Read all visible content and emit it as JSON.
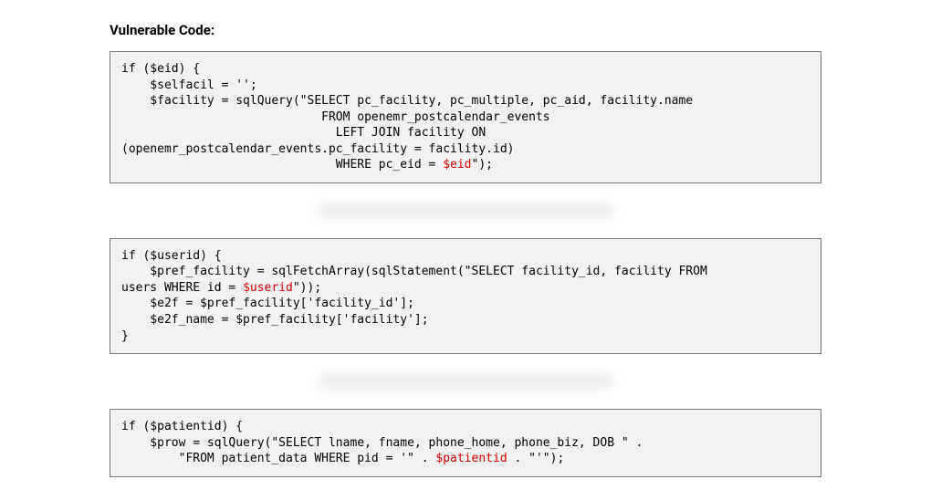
{
  "heading": "Vulnerable Code:",
  "code1": {
    "l1": "if ($eid) {",
    "l2": "    $selfacil = '';",
    "l3a": "    $facility = sqlQuery(\"SELECT pc_facility, pc_multiple, pc_aid, facility.name",
    "l4": "                            FROM openemr_postcalendar_events",
    "l5": "                              LEFT JOIN facility ON ",
    "l5b": "(openemr_postcalendar_events.pc_facility = facility.id)",
    "l6a": "                              WHERE pc_eid = ",
    "l6var": "$eid",
    "l6b": "\");"
  },
  "code2": {
    "l1": "if ($userid) {",
    "l2a": "    $pref_facility = sqlFetchArray(sqlStatement(\"SELECT facility_id, facility FROM ",
    "l2b": "users WHERE id = ",
    "l2var": "$userid",
    "l2c": "\"));",
    "l3": "    $e2f = $pref_facility['facility_id'];",
    "l4": "    $e2f_name = $pref_facility['facility'];",
    "l5": "}"
  },
  "code3": {
    "l1": "if ($patientid) {",
    "l2": "    $prow = sqlQuery(\"SELECT lname, fname, phone_home, phone_biz, DOB \" .",
    "l3a": "        \"FROM patient_data WHERE pid = '\" . ",
    "l3var": "$patientid",
    "l3b": " . \"'\");"
  }
}
